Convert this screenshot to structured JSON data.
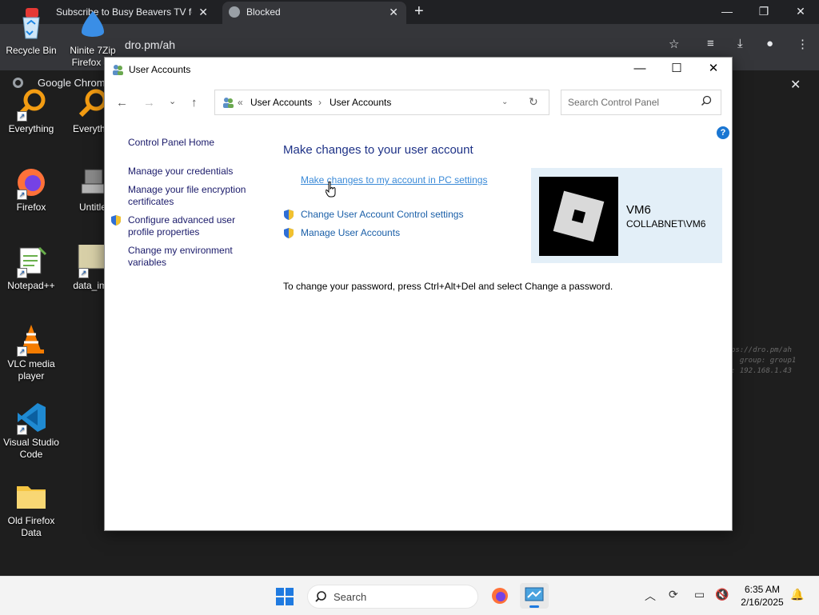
{
  "browser": {
    "tabs": [
      {
        "title": "Subscribe to Busy Beavers TV fo"
      },
      {
        "title": "Blocked"
      }
    ],
    "url": "dro.pm/ah",
    "bookmark": "Google Chrom"
  },
  "terminal_text": "ps://dro.pm/ah\n  group: group1\n: 192.168.1.43",
  "desktop": {
    "icons": [
      {
        "label": "Recycle Bin"
      },
      {
        "label": "Ninite 7Zip Firefox Ja"
      },
      {
        "label": "Everything"
      },
      {
        "label": "Everythin"
      },
      {
        "label": "Firefox"
      },
      {
        "label": "Untitle"
      },
      {
        "label": "Notepad++"
      },
      {
        "label": "data_ima"
      },
      {
        "label": "VLC media player"
      },
      {
        "label": "Visual Studio Code"
      },
      {
        "label": "Old Firefox Data"
      }
    ]
  },
  "window": {
    "title": "User Accounts",
    "controls": {
      "minimize": "—",
      "maximize": "☐",
      "close": "✕"
    },
    "address": {
      "chevron": "«",
      "crumbs": [
        "User Accounts",
        "User Accounts"
      ]
    },
    "search_placeholder": "Search Control Panel",
    "help": "?",
    "left_nav": [
      "Control Panel Home",
      "Manage your credentials",
      "Manage your file encryption certificates",
      "Configure advanced user profile properties",
      "Change my environment variables"
    ],
    "heading": "Make changes to your user account",
    "links": [
      "Make changes to my account in PC settings",
      "Change User Account Control settings",
      "Manage User Accounts"
    ],
    "note": "To change your password, press Ctrl+Alt+Del and select Change a password.",
    "user": {
      "name": "VM6",
      "account": "COLLABNET\\VM6"
    }
  },
  "taskbar": {
    "search_label": "Search",
    "time": "6:35 AM",
    "date": "2/16/2025"
  },
  "colors": {
    "accent": "#1a5fa8",
    "heading": "#1e3287",
    "card": "#e3eff8"
  }
}
